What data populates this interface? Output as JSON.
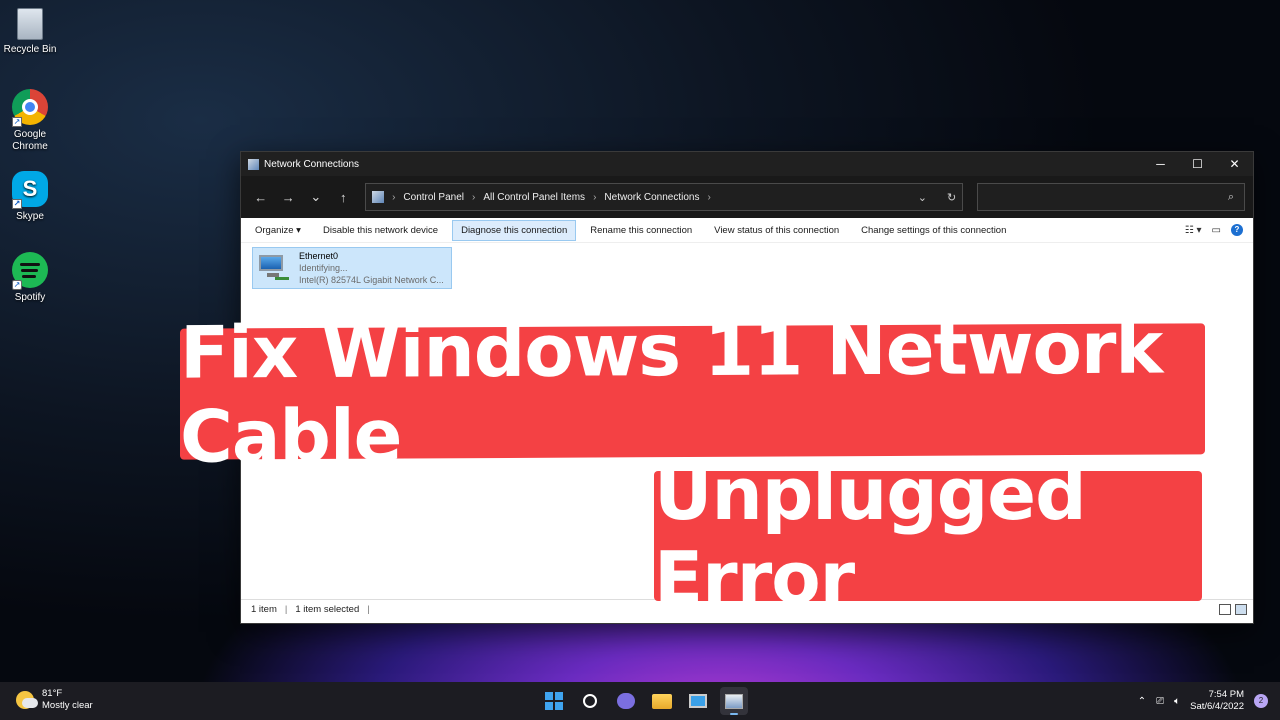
{
  "desktop": {
    "icons": [
      {
        "label": "Recycle Bin",
        "icon": "recycle-bin-icon"
      },
      {
        "label": "Google Chrome",
        "icon": "chrome-icon"
      },
      {
        "label": "Skype",
        "icon": "skype-icon"
      },
      {
        "label": "Spotify",
        "icon": "spotify-icon"
      }
    ]
  },
  "window": {
    "title": "Network Connections",
    "controls": {
      "minimize": "─",
      "maximize": "☐",
      "close": "✕"
    },
    "nav": {
      "back": "←",
      "forward": "→",
      "recent": "⌄",
      "up": "↑"
    },
    "breadcrumb": [
      "Control Panel",
      "All Control Panel Items",
      "Network Connections"
    ],
    "search_placeholder": "",
    "commands": [
      {
        "label": "Organize ▾",
        "active": false
      },
      {
        "label": "Disable this network device",
        "active": false
      },
      {
        "label": "Diagnose this connection",
        "active": true
      },
      {
        "label": "Rename this connection",
        "active": false
      },
      {
        "label": "View status of this connection",
        "active": false
      },
      {
        "label": "Change settings of this connection",
        "active": false
      }
    ],
    "item": {
      "name": "Ethernet0",
      "status": "Identifying...",
      "device": "Intel(R) 82574L Gigabit Network C..."
    },
    "status_bar": {
      "count": "1 item",
      "selected": "1 item selected"
    }
  },
  "overlay": {
    "line1": "Fix Windows 11 Network Cable",
    "line2": "Unplugged Error",
    "color": "#f44144"
  },
  "taskbar": {
    "weather": {
      "temp": "81°F",
      "condition": "Mostly clear"
    },
    "clock": {
      "time": "7:54 PM",
      "date": "Sat/6/4/2022"
    },
    "notification_count": "2"
  }
}
